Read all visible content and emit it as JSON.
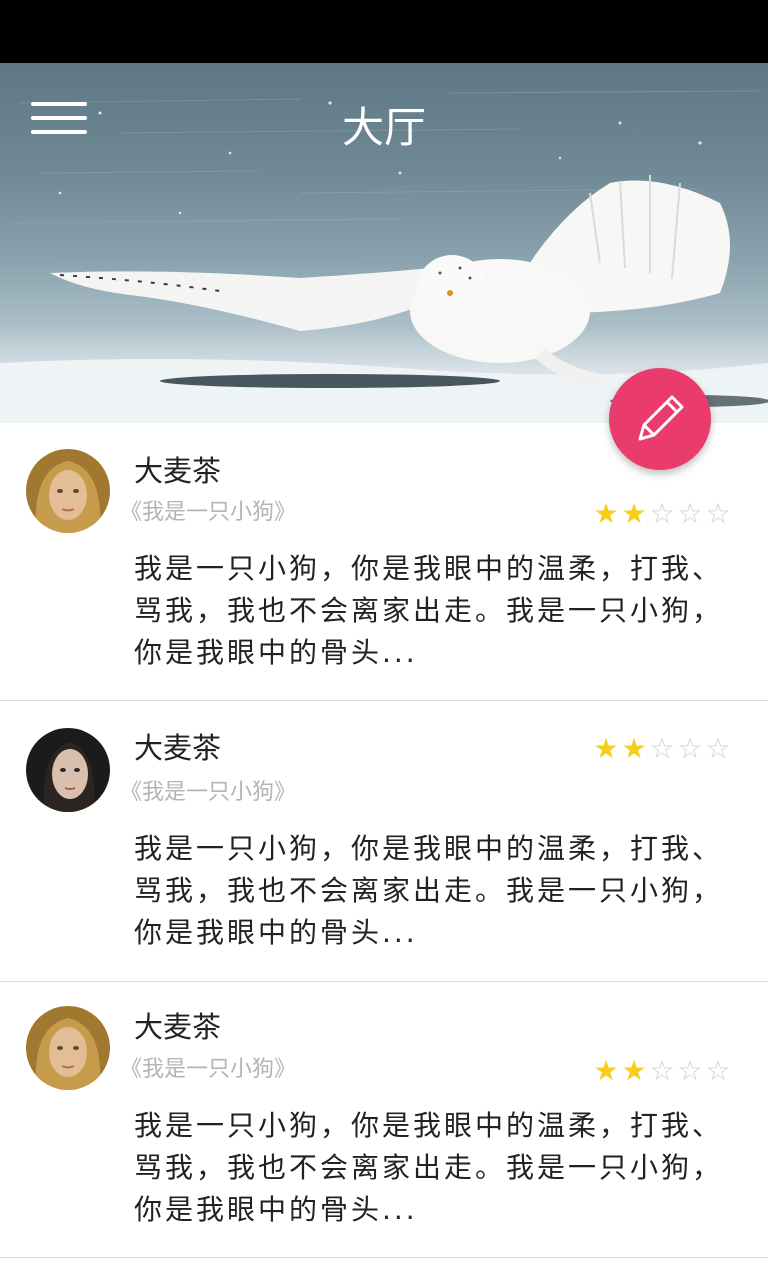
{
  "header": {
    "title": "大厅"
  },
  "posts": [
    {
      "name": "大麦茶",
      "book": "《我是一只小狗》",
      "rating": 2,
      "rating_max": 5,
      "lines": [
        "我是一只小狗，你是我眼中的温柔，打我、",
        "骂我，我也不会离家出走。我是一只小狗，",
        "你是我眼中的骨头..."
      ]
    },
    {
      "name": "大麦茶",
      "book": "《我是一只小狗》",
      "rating": 2,
      "rating_max": 5,
      "lines": [
        "我是一只小狗，你是我眼中的温柔，打我、",
        "骂我，我也不会离家出走。我是一只小狗，",
        "你是我眼中的骨头..."
      ]
    },
    {
      "name": "大麦茶",
      "book": "《我是一只小狗》",
      "rating": 2,
      "rating_max": 5,
      "lines": [
        "我是一只小狗，你是我眼中的温柔，打我、",
        "骂我，我也不会离家出走。我是一只小狗，",
        "你是我眼中的骨头..."
      ]
    }
  ],
  "colors": {
    "accent": "#ea3c6c",
    "star_on": "#f5cd1b",
    "star_off": "#cfcfcf",
    "muted": "#b4b4b4"
  },
  "icons": {
    "menu": "hamburger-icon",
    "compose": "pencil-icon",
    "star": "star-icon"
  }
}
